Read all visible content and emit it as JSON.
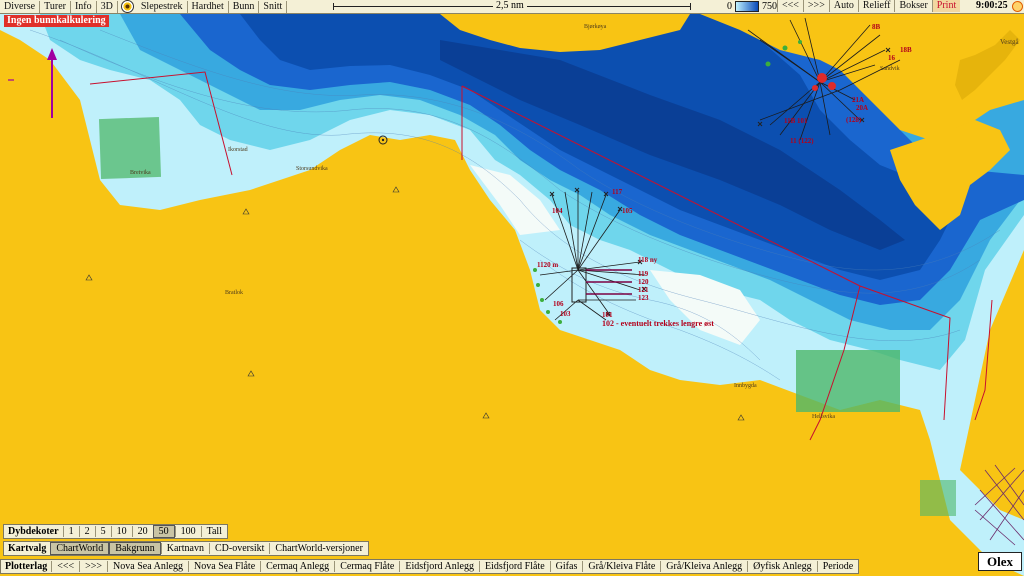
{
  "menu": {
    "items": [
      "Diverse",
      "Turer",
      "Info",
      "3D",
      "Slepestrek",
      "Hardhet",
      "Bunn",
      "Snitt"
    ]
  },
  "scale_label": "2,5 nm",
  "depth_legend": {
    "min": "0",
    "max": "750"
  },
  "right_menu": [
    "<<<",
    ">>>",
    "Auto",
    "Relieff",
    "Bokser",
    "Print"
  ],
  "clock": "9:00:25",
  "warning": "Ingen bunnkalkulering",
  "place_names": {
    "bjorkoy": "Bjørkøya",
    "vestg": "Vestgå",
    "ikorstad": "Ikorstad",
    "storsund": "Storsundvika",
    "bretvika": "Bretvika",
    "bratlok": "Bratlok",
    "hellsvika": "Hellsvika",
    "innbygda": "Innbygda",
    "sandvik": "Sandvik",
    "annot": "102 - eventuelt trekkes lengre øst"
  },
  "marker_labels": {
    "m104": "104",
    "m117": "117",
    "m105": "105",
    "m118": "118 ny",
    "m119": "119",
    "m120": "120",
    "m121": "121",
    "m122": "122",
    "m123": "123",
    "m103": "103",
    "m101": "101",
    "m106": "106",
    "m1120": "1120 m",
    "m8b": "8B",
    "m18b": "18B",
    "m16": "16",
    "m101b": "101",
    "m122b": "11 (122)",
    "m21a": "21A",
    "m20a": "20A",
    "m128": "(128)",
    "m11": "11B 101"
  },
  "dybdekoter": {
    "label": "Dybdekoter",
    "values": [
      "1",
      "2",
      "5",
      "10",
      "20",
      "50",
      "100",
      "Tall"
    ],
    "selected": "50"
  },
  "kartvalg": {
    "label": "Kartvalg",
    "items": [
      "ChartWorld",
      "Bakgrunn",
      "Kartnavn",
      "CD-oversikt",
      "ChartWorld-versjoner"
    ],
    "selected": [
      "ChartWorld",
      "Bakgrunn"
    ]
  },
  "plotterlag": {
    "label": "Plotterlag",
    "nav": [
      "<<<",
      ">>>"
    ],
    "items": [
      "Nova Sea Anlegg",
      "Nova Sea Flåte",
      "Cermaq Anlegg",
      "Cermaq Flåte",
      "Eidsfjord Anlegg",
      "Eidsfjord Flåte",
      "Gifas",
      "Grå/Kleiva Flåte",
      "Grå/Kleiva Anlegg",
      "Øyfisk Anlegg",
      "Periode"
    ]
  },
  "brand": "Olex",
  "colors": {
    "land": "#f8c414",
    "deep": "#1a5fc8",
    "shallow": "#8fe3f0",
    "route": "#c8102e",
    "farm": "#4fb86a"
  }
}
